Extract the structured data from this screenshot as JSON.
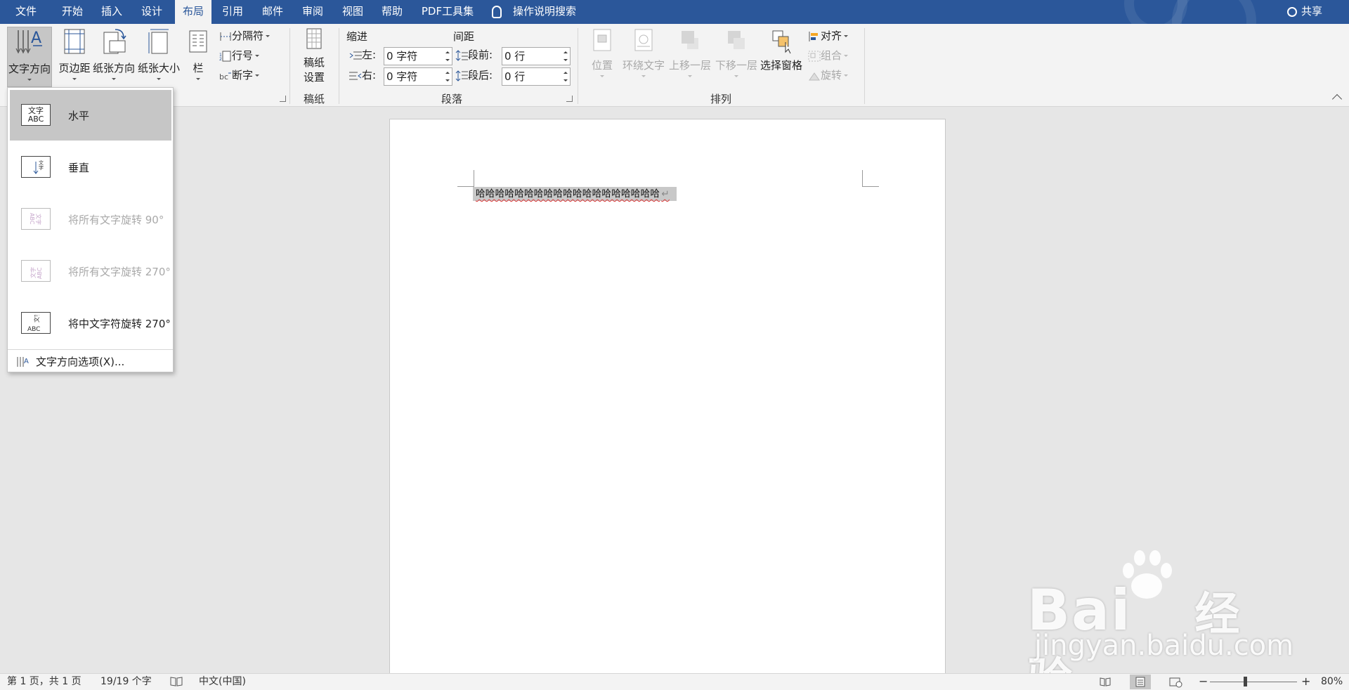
{
  "tabs": [
    "文件",
    "开始",
    "插入",
    "设计",
    "布局",
    "引用",
    "邮件",
    "审阅",
    "视图",
    "帮助",
    "PDF工具集"
  ],
  "active_tab": "布局",
  "search_label": "操作说明搜索",
  "share_label": "共享",
  "ribbon": {
    "page_setup": {
      "text_direction": "文字方向",
      "margins": "页边距",
      "orientation": "纸张方向",
      "size": "纸张大小",
      "columns": "栏",
      "breaks": "分隔符",
      "line_numbers": "行号",
      "hyphenation": "断字"
    },
    "manuscript": {
      "button_line1": "稿纸",
      "button_line2": "设置",
      "group_label": "稿纸"
    },
    "paragraph": {
      "group_label": "段落",
      "indent_title": "缩进",
      "spacing_title": "间距",
      "left_label": "左:",
      "right_label": "右:",
      "before_label": "段前:",
      "after_label": "段后:",
      "left_value": "0 字符",
      "right_value": "0 字符",
      "before_value": "0 行",
      "after_value": "0 行"
    },
    "arrange": {
      "group_label": "排列",
      "position": "位置",
      "wrap_text": "环绕文字",
      "bring_forward": "上移一层",
      "send_backward": "下移一层",
      "selection_pane": "选择窗格",
      "align": "对齐",
      "group": "组合",
      "rotate": "旋转"
    }
  },
  "text_direction_menu": {
    "items": [
      {
        "label": "水平",
        "icon_text": "文字\nABC",
        "state": "selected"
      },
      {
        "label": "垂直",
        "icon_text": "",
        "state": "normal"
      },
      {
        "label": "将所有文字旋转 90°",
        "icon_text": "",
        "state": "disabled"
      },
      {
        "label": "将所有文字旋转 270°",
        "icon_text": "",
        "state": "disabled"
      },
      {
        "label": "将中文字符旋转 270°",
        "icon_text": "",
        "state": "normal"
      }
    ],
    "options_label": "文字方向选项(X)..."
  },
  "document": {
    "text": "哈哈哈哈哈哈哈哈哈哈哈哈哈哈哈哈哈哈哈"
  },
  "status": {
    "page": "第 1 页，共 1 页",
    "words": "19/19 个字",
    "language": "中文(中国)",
    "zoom": "80%",
    "zoom_minus": "−",
    "zoom_plus": "+"
  },
  "watermark": {
    "brand": "Bai",
    "brand_suffix": "经验",
    "url": "jingyan.baidu.com"
  },
  "colors": {
    "accent": "#2b579a",
    "ribbon_bg": "#f3f3f3",
    "selection": "#c6c6c6"
  }
}
